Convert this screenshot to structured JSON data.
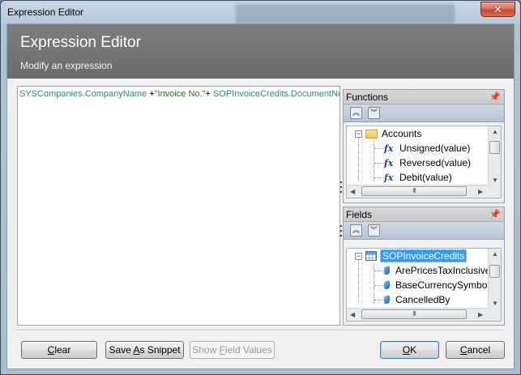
{
  "window": {
    "title": "Expression Editor",
    "close_glyph": "✕"
  },
  "header": {
    "title": "Expression Editor",
    "subtitle": "Modify an expression"
  },
  "editor": {
    "tokens": [
      {
        "text": "SYSCompanies.CompanyName",
        "kind": "field"
      },
      {
        "text": " +",
        "kind": "op"
      },
      {
        "text": "\"Invoice No.\"",
        "kind": "string"
      },
      {
        "text": "+ ",
        "kind": "op"
      },
      {
        "text": "SOPInvoiceCredits.DocumentNo",
        "kind": "field"
      }
    ]
  },
  "functions_panel": {
    "title": "Functions",
    "pin_icon": "pin-icon",
    "collapse_all_glyph": "︽",
    "expand_all_glyph": "︾",
    "tree": {
      "folder": "Accounts",
      "items": [
        "Unsigned(value)",
        "Reversed(value)",
        "Debit(value)"
      ]
    }
  },
  "fields_panel": {
    "title": "Fields",
    "pin_icon": "pin-icon",
    "collapse_all_glyph": "︽",
    "expand_all_glyph": "︾",
    "tree": {
      "table": "SOPInvoiceCredits",
      "items": [
        "ArePricesTaxInclusive",
        "BaseCurrencySymbol",
        "CancelledBy"
      ]
    }
  },
  "buttons": {
    "clear": {
      "pre": "",
      "u": "C",
      "post": "lear"
    },
    "save_snippet": {
      "pre": "Save ",
      "u": "A",
      "post": "s Snippet"
    },
    "show_field_values": {
      "pre": "Show ",
      "u": "F",
      "post": "ield Values"
    },
    "ok": {
      "pre": "",
      "u": "O",
      "post": "K"
    },
    "cancel": {
      "pre": "",
      "u": "C",
      "post": "ancel"
    }
  },
  "colors": {
    "header_bg": "#757575",
    "field_token": "#2e8a8a",
    "string_token": "#2a7a20",
    "selection": "#3399ff"
  }
}
